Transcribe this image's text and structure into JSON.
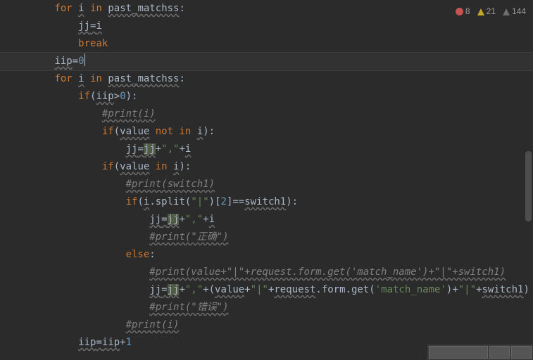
{
  "status": {
    "errors": "8",
    "warnings": "21",
    "typos": "144"
  },
  "indent": "    ",
  "cursor_line_index": 3,
  "lines": [
    {
      "i": 2,
      "tokens": [
        [
          "kw",
          "for"
        ],
        [
          "op",
          " "
        ],
        [
          "id squig",
          "i"
        ],
        [
          "op",
          " "
        ],
        [
          "kw",
          "in"
        ],
        [
          "op",
          " "
        ],
        [
          "id squig",
          "past_matchss"
        ],
        [
          "op",
          ":"
        ]
      ]
    },
    {
      "i": 3,
      "tokens": [
        [
          "id squig",
          "jj"
        ],
        [
          "op squig",
          "="
        ],
        [
          "id squig",
          "i"
        ]
      ]
    },
    {
      "i": 3,
      "tokens": [
        [
          "kw",
          "break"
        ]
      ]
    },
    {
      "i": 2,
      "tokens": [
        [
          "id squig",
          "iip"
        ],
        [
          "op",
          "="
        ],
        [
          "num",
          "0"
        ]
      ],
      "caret": true
    },
    {
      "i": 2,
      "tokens": [
        [
          "kw",
          "for"
        ],
        [
          "op",
          " "
        ],
        [
          "id squig",
          "i"
        ],
        [
          "op",
          " "
        ],
        [
          "kw",
          "in"
        ],
        [
          "op",
          " "
        ],
        [
          "id squig",
          "past_matchss"
        ],
        [
          "op",
          ":"
        ]
      ]
    },
    {
      "i": 3,
      "tokens": [
        [
          "kw",
          "if"
        ],
        [
          "op",
          "("
        ],
        [
          "id squig",
          "iip"
        ],
        [
          "op",
          ">"
        ],
        [
          "num",
          "0"
        ],
        [
          "op",
          "):"
        ]
      ]
    },
    {
      "i": 4,
      "tokens": [
        [
          "cmt squig",
          "#print(i)"
        ]
      ]
    },
    {
      "i": 4,
      "tokens": [
        [
          "kw",
          "if"
        ],
        [
          "op",
          "("
        ],
        [
          "id squig",
          "value"
        ],
        [
          "op",
          " "
        ],
        [
          "kw",
          "not in"
        ],
        [
          "op",
          " "
        ],
        [
          "id squig",
          "i"
        ],
        [
          "op",
          "):"
        ]
      ]
    },
    {
      "i": 5,
      "tokens": [
        [
          "id squig",
          "jj"
        ],
        [
          "op squig",
          "="
        ],
        [
          "id squig hl",
          "jj"
        ],
        [
          "op",
          "+"
        ],
        [
          "str",
          "\",\""
        ],
        [
          "op",
          "+"
        ],
        [
          "id squig",
          "i"
        ]
      ]
    },
    {
      "i": 4,
      "tokens": [
        [
          "kw",
          "if"
        ],
        [
          "op",
          "("
        ],
        [
          "id squig",
          "value"
        ],
        [
          "op",
          " "
        ],
        [
          "kw",
          "in"
        ],
        [
          "op",
          " "
        ],
        [
          "id squig",
          "i"
        ],
        [
          "op",
          "):"
        ]
      ]
    },
    {
      "i": 5,
      "tokens": [
        [
          "cmt squig",
          "#print(switch1)"
        ]
      ]
    },
    {
      "i": 5,
      "tokens": [
        [
          "kw",
          "if"
        ],
        [
          "op",
          "("
        ],
        [
          "id squig",
          "i"
        ],
        [
          "op",
          "."
        ],
        [
          "id",
          "split"
        ],
        [
          "op",
          "("
        ],
        [
          "str",
          "\"|\""
        ],
        [
          "op",
          ")["
        ],
        [
          "num",
          "2"
        ],
        [
          "op",
          "]=="
        ],
        [
          "id squig",
          "switch1"
        ],
        [
          "op",
          "):"
        ]
      ]
    },
    {
      "i": 6,
      "tokens": [
        [
          "id squig",
          "jj"
        ],
        [
          "op squig",
          "="
        ],
        [
          "id squig hl",
          "jj"
        ],
        [
          "op",
          "+"
        ],
        [
          "str",
          "\",\""
        ],
        [
          "op",
          "+"
        ],
        [
          "id squig",
          "i"
        ]
      ]
    },
    {
      "i": 6,
      "tokens": [
        [
          "cmt squig",
          "#print(\"正确\")"
        ]
      ]
    },
    {
      "i": 5,
      "tokens": [
        [
          "kw",
          "else"
        ],
        [
          "op",
          ":"
        ]
      ]
    },
    {
      "i": 6,
      "tokens": [
        [
          "cmt squig",
          "#print(value+\"|\"+request.form.get('match_name')+\"|\"+switch1)"
        ]
      ]
    },
    {
      "i": 6,
      "tokens": [
        [
          "id squig",
          "jj"
        ],
        [
          "op squig",
          "="
        ],
        [
          "id squig hl",
          "jj"
        ],
        [
          "op",
          "+"
        ],
        [
          "str",
          "\",\""
        ],
        [
          "op",
          "+("
        ],
        [
          "id squig",
          "value"
        ],
        [
          "op",
          "+"
        ],
        [
          "str",
          "\"|\""
        ],
        [
          "op",
          "+"
        ],
        [
          "id squig",
          "request"
        ],
        [
          "op",
          "."
        ],
        [
          "id",
          "form"
        ],
        [
          "op",
          "."
        ],
        [
          "id",
          "get"
        ],
        [
          "op",
          "("
        ],
        [
          "str",
          "'match_name'"
        ],
        [
          "op",
          ")+"
        ],
        [
          "str",
          "\"|\""
        ],
        [
          "op",
          "+"
        ],
        [
          "id squig",
          "switch1"
        ],
        [
          "op",
          ")"
        ]
      ]
    },
    {
      "i": 6,
      "tokens": [
        [
          "cmt squig",
          "#print(\"错误\")"
        ]
      ]
    },
    {
      "i": 5,
      "tokens": [
        [
          "cmt squig",
          "#print(i)"
        ]
      ]
    },
    {
      "i": 3,
      "tokens": [
        [
          "id squig",
          "iip"
        ],
        [
          "op squig",
          "="
        ],
        [
          "id squig",
          "iip"
        ],
        [
          "op",
          "+"
        ],
        [
          "num",
          "1"
        ]
      ]
    }
  ]
}
